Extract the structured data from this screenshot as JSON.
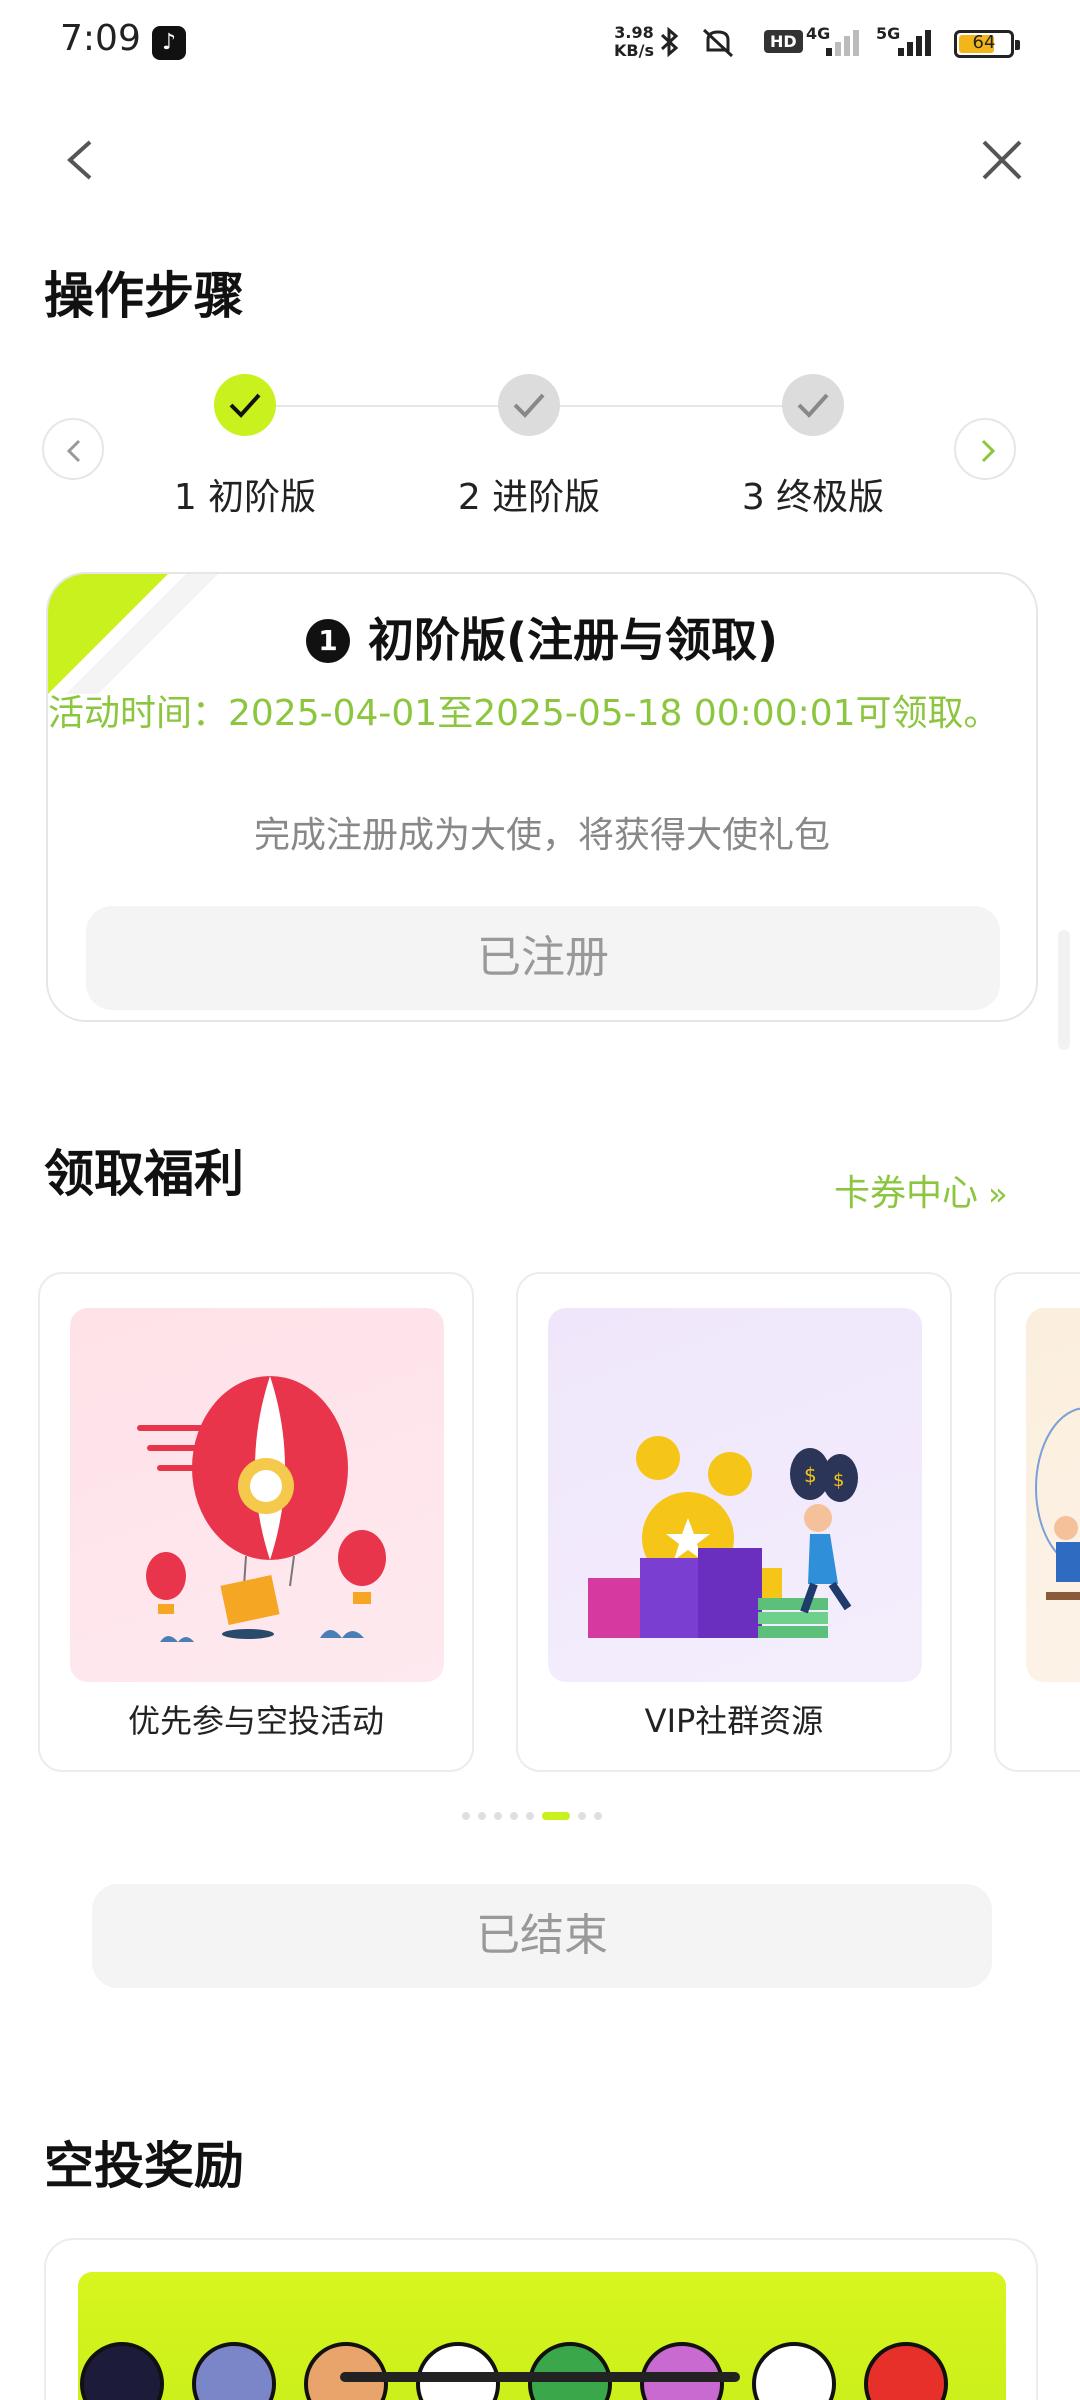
{
  "status_bar": {
    "time": "7:09",
    "speed_value": "3.98",
    "speed_unit": "KB/s",
    "network_1": "4G",
    "network_2": "5G",
    "battery": "64"
  },
  "steps_section": {
    "title": "操作步骤",
    "steps": [
      {
        "label": "1 初阶版",
        "state": "completed"
      },
      {
        "label": "2 进阶版",
        "state": "pending"
      },
      {
        "label": "3 终极版",
        "state": "pending"
      }
    ]
  },
  "stage_card": {
    "badge": "1",
    "title": "初阶版(注册与领取)",
    "time": "活动时间：2025-04-01至2025-05-18 00:00:01可领取。",
    "description": "完成注册成为大使，将获得大使礼包",
    "button": "已注册"
  },
  "benefits": {
    "title": "领取福利",
    "link": "卡券中心",
    "items": [
      {
        "label": "优先参与空投活动",
        "icon": "hot-air-balloon-illustration"
      },
      {
        "label": "VIP社群资源",
        "icon": "money-bags-podium-illustration"
      }
    ],
    "carousel_pages": 8,
    "carousel_active": 6
  },
  "ended_button": "已结束",
  "airdrop": {
    "title": "空投奖励"
  },
  "colors": {
    "accent": "#c8f11e",
    "accent_text": "#8cc63f"
  }
}
